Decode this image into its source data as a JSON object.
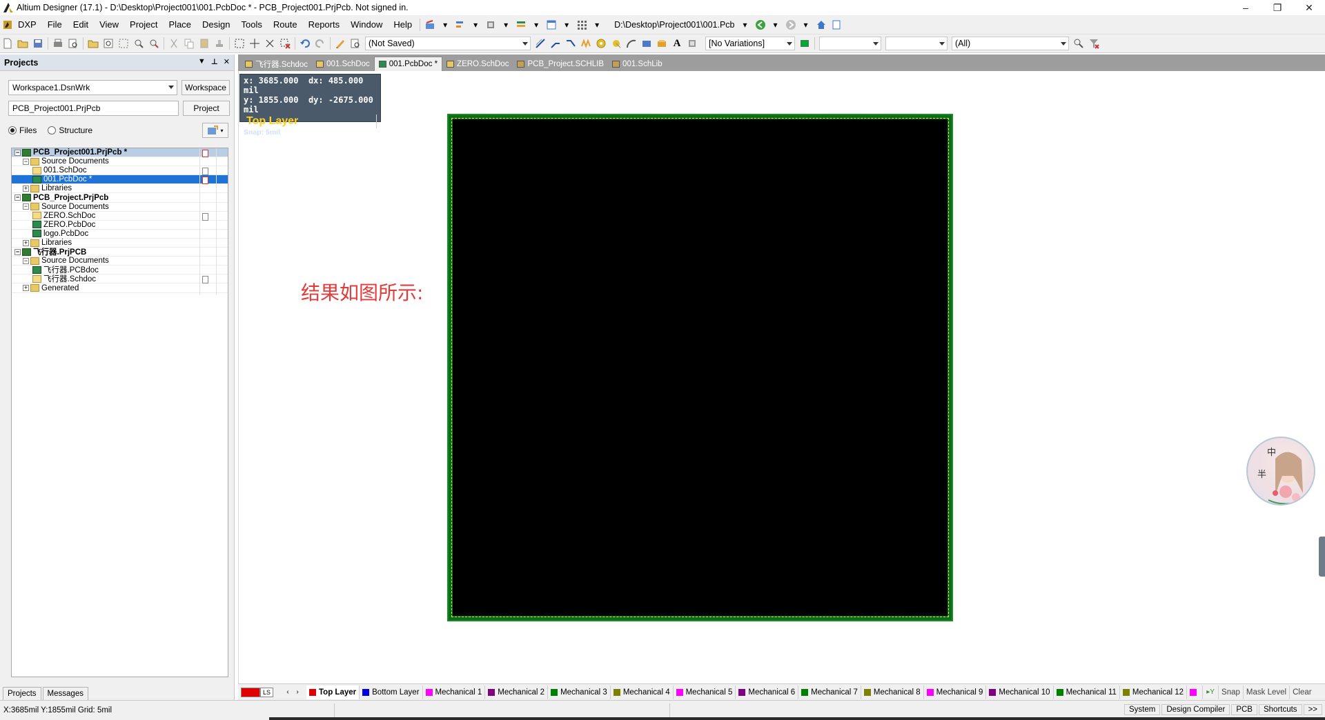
{
  "window": {
    "title": "Altium Designer (17.1) - D:\\Desktop\\Project001\\001.PcbDoc * - PCB_Project001.PrjPcb. Not signed in.",
    "minimize": "–",
    "maximize": "❐",
    "close": "✕"
  },
  "menu": {
    "items": [
      "DXP",
      "File",
      "Edit",
      "View",
      "Project",
      "Place",
      "Design",
      "Tools",
      "Route",
      "Reports",
      "Window",
      "Help"
    ],
    "path": "D:\\Desktop\\Project001\\001.Pcb"
  },
  "toolbar": {
    "saved_state": "(Not Saved)",
    "variations": "[No Variations]",
    "filter": "(All)"
  },
  "panel": {
    "title": "Projects",
    "workspace_value": "Workspace1.DsnWrk",
    "workspace_button": "Workspace",
    "project_value": "PCB_Project001.PrjPcb",
    "project_button": "Project",
    "radio_files": "Files",
    "radio_structure": "Structure",
    "tabs": [
      "Projects",
      "Messages"
    ]
  },
  "tree": [
    {
      "label": "PCB_Project001.PrjPcb *",
      "level": 0,
      "icon": "proj",
      "exp": "−",
      "state": "sel1",
      "mark": "red"
    },
    {
      "label": "Source Documents",
      "level": 1,
      "icon": "folder",
      "exp": "−"
    },
    {
      "label": "001.SchDoc",
      "level": 2,
      "icon": "sch",
      "mark": "gray"
    },
    {
      "label": "001.PcbDoc *",
      "level": 2,
      "icon": "pcb",
      "state": "sel2",
      "mark": "red"
    },
    {
      "label": "Libraries",
      "level": 1,
      "icon": "folder",
      "exp": "+"
    },
    {
      "label": "PCB_Project.PrjPcb",
      "level": 0,
      "icon": "proj",
      "exp": "−",
      "state": "bold"
    },
    {
      "label": "Source Documents",
      "level": 1,
      "icon": "folder",
      "exp": "−"
    },
    {
      "label": "ZERO.SchDoc",
      "level": 2,
      "icon": "sch",
      "mark": "gray"
    },
    {
      "label": "ZERO.PcbDoc",
      "level": 2,
      "icon": "pcb"
    },
    {
      "label": "logo.PcbDoc",
      "level": 2,
      "icon": "pcb"
    },
    {
      "label": "Libraries",
      "level": 1,
      "icon": "folder",
      "exp": "+"
    },
    {
      "label": "飞行器.PrjPCB",
      "level": 0,
      "icon": "proj",
      "exp": "−",
      "state": "bold"
    },
    {
      "label": "Source Documents",
      "level": 1,
      "icon": "folder",
      "exp": "−"
    },
    {
      "label": "飞行器.PCBdoc",
      "level": 2,
      "icon": "pcb"
    },
    {
      "label": "飞行器.Schdoc",
      "level": 2,
      "icon": "sch",
      "mark": "gray"
    },
    {
      "label": "Generated",
      "level": 1,
      "icon": "folder",
      "exp": "+"
    }
  ],
  "doc_tabs": [
    {
      "label": "飞行器.Schdoc",
      "color": "#e8c760"
    },
    {
      "label": "001.SchDoc",
      "color": "#e8c760"
    },
    {
      "label": "001.PcbDoc *",
      "color": "#2c8a4c",
      "active": true
    },
    {
      "label": "ZERO.SchDoc",
      "color": "#e8c760"
    },
    {
      "label": "PCB_Project.SCHLIB",
      "color": "#c5a050"
    },
    {
      "label": "001.SchLib",
      "color": "#c5a050"
    }
  ],
  "hud": {
    "x": "x: 3685.000",
    "dx": "dx:  485.000  mil",
    "y": "y: 1855.000",
    "dy": "dy: -2675.000  mil",
    "layer": "Top Layer",
    "snap": "Snap: 5mil"
  },
  "annotation": "结果如图所示:",
  "avatar": {
    "c1": "中",
    "c2": "半"
  },
  "layers": [
    {
      "name": "Top Layer",
      "color": "#e00000",
      "active": true
    },
    {
      "name": "Bottom Layer",
      "color": "#0000e0"
    },
    {
      "name": "Mechanical 1",
      "color": "#ff00ff"
    },
    {
      "name": "Mechanical 2",
      "color": "#800080"
    },
    {
      "name": "Mechanical 3",
      "color": "#008000"
    },
    {
      "name": "Mechanical 4",
      "color": "#808000"
    },
    {
      "name": "Mechanical 5",
      "color": "#ff00ff"
    },
    {
      "name": "Mechanical 6",
      "color": "#800080"
    },
    {
      "name": "Mechanical 7",
      "color": "#008000"
    },
    {
      "name": "Mechanical 8",
      "color": "#808000"
    },
    {
      "name": "Mechanical 9",
      "color": "#ff00ff"
    },
    {
      "name": "Mechanical 10",
      "color": "#800080"
    },
    {
      "name": "Mechanical 11",
      "color": "#008000"
    },
    {
      "name": "Mechanical 12",
      "color": "#808000"
    }
  ],
  "layerbar": {
    "ls": "LS",
    "snap": "Snap",
    "mask": "Mask Level",
    "clear": "Clear"
  },
  "status": {
    "coords": "X:3685mil Y:1855mil   Grid: 5mil",
    "buttons": [
      "System",
      "Design Compiler",
      "PCB",
      "Shortcuts",
      ">>"
    ]
  }
}
